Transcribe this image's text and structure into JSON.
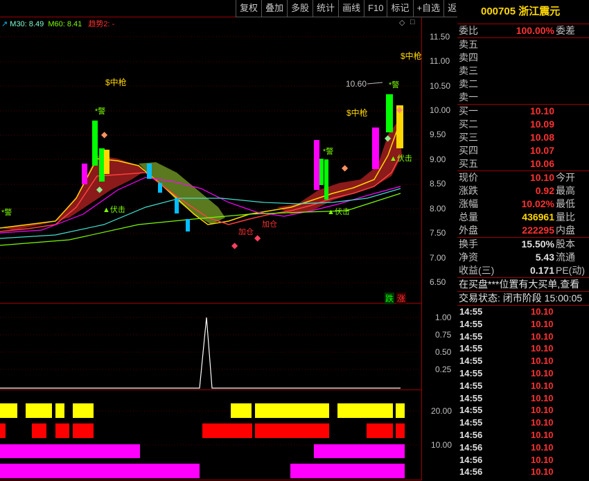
{
  "toolbar": {
    "buttons": [
      "复权",
      "叠加",
      "多股",
      "统计",
      "画线",
      "F10",
      "标记",
      "+自选",
      "返回"
    ]
  },
  "indicators": {
    "ma30": "M30: 8.49",
    "ma60": "M60: 8.41",
    "trend": "趋势2: -"
  },
  "main_axis": [
    "11.50",
    "11.00",
    "10.50",
    "10.00",
    "9.50",
    "9.00",
    "8.50",
    "8.00",
    "7.50",
    "7.00",
    "6.50"
  ],
  "sub1_axis": [
    "1.00",
    "0.75",
    "0.50",
    "0.25"
  ],
  "sub2_axis": [
    "20.00",
    "10.00"
  ],
  "chart_labels": {
    "zhong1": "$中枪",
    "zhong2": "$中枪",
    "zhong3": "$中枪",
    "jing1": "*警",
    "jing2": "*警",
    "jing3": "*警",
    "jing4": "*警",
    "fuji1": "▲伏击",
    "fuji2": "▲伏击",
    "fuji3": "▲伏击",
    "jiacang1": "加仓",
    "jiacang2": "加仓",
    "high_price": "10.60",
    "die": "跌",
    "zhang": "涨"
  },
  "panel": {
    "code": "000705",
    "name": "浙江震元",
    "weibi_label": "委比",
    "weibi_value": "100.00%",
    "weicha_label": "委差",
    "sell": [
      "卖五",
      "卖四",
      "卖三",
      "卖二",
      "卖一"
    ],
    "buy": [
      {
        "label": "买一",
        "price": "10.10"
      },
      {
        "label": "买二",
        "price": "10.09"
      },
      {
        "label": "买三",
        "price": "10.08"
      },
      {
        "label": "买四",
        "price": "10.07"
      },
      {
        "label": "买五",
        "price": "10.06"
      }
    ],
    "quote": [
      {
        "l": "现价",
        "v": "10.10",
        "r": "今开",
        "c": "red"
      },
      {
        "l": "涨跌",
        "v": "0.92",
        "r": "最高",
        "c": "red"
      },
      {
        "l": "涨幅",
        "v": "10.02%",
        "r": "最低",
        "c": "red"
      },
      {
        "l": "总量",
        "v": "436961",
        "r": "量比",
        "c": "yel"
      },
      {
        "l": "外盘",
        "v": "222295",
        "r": "内盘",
        "c": "red"
      }
    ],
    "fin": [
      {
        "l": "换手",
        "v": "15.50%",
        "r": "股本"
      },
      {
        "l": "净资",
        "v": "5.43",
        "r": "流通"
      },
      {
        "l": "收益(三)",
        "v": "0.171",
        "r": "PE(动)"
      }
    ],
    "notice": "在买盘***位置有大买单,查看",
    "status": "交易状态: 闭市阶段 15:00:05",
    "ticks": [
      {
        "t": "14:55",
        "p": "10.10"
      },
      {
        "t": "14:55",
        "p": "10.10"
      },
      {
        "t": "14:55",
        "p": "10.10"
      },
      {
        "t": "14:55",
        "p": "10.10"
      },
      {
        "t": "14:55",
        "p": "10.10"
      },
      {
        "t": "14:55",
        "p": "10.10"
      },
      {
        "t": "14:55",
        "p": "10.10"
      },
      {
        "t": "14:55",
        "p": "10.10"
      },
      {
        "t": "14:55",
        "p": "10.10"
      },
      {
        "t": "14:55",
        "p": "10.10"
      },
      {
        "t": "14:56",
        "p": "10.10"
      },
      {
        "t": "14:56",
        "p": "10.10"
      },
      {
        "t": "14:56",
        "p": "10.10"
      },
      {
        "t": "14:56",
        "p": "10.10"
      }
    ]
  }
}
